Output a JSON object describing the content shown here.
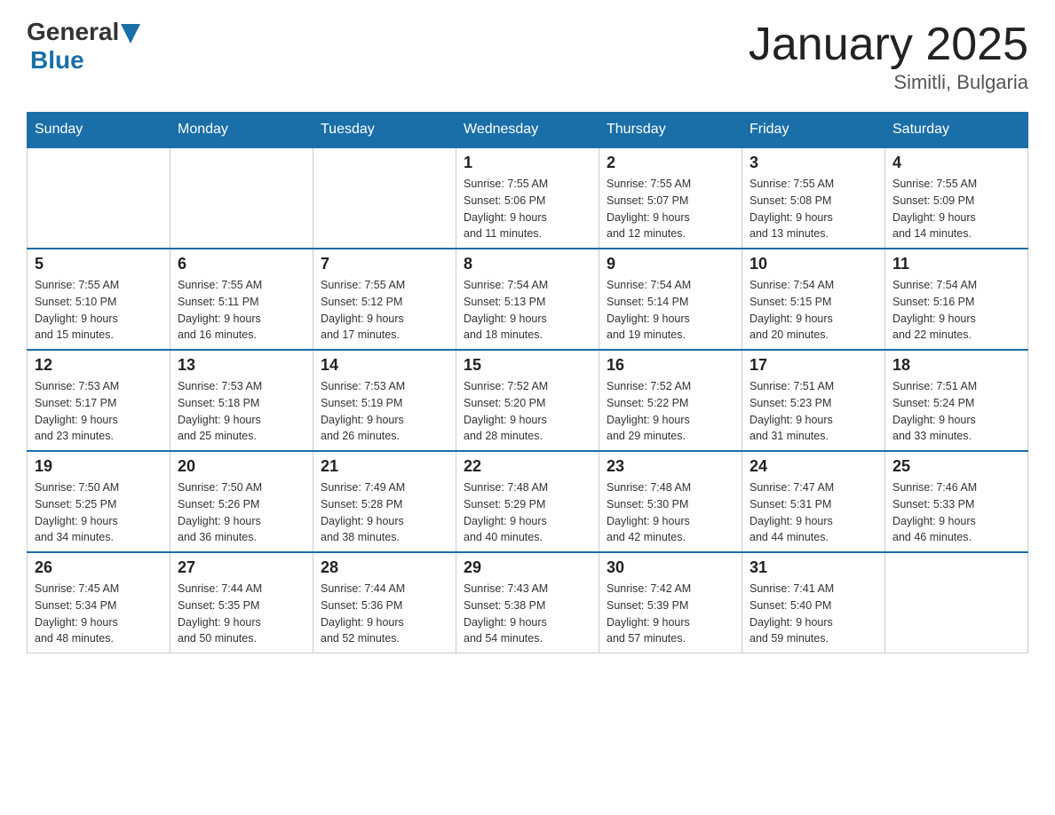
{
  "header": {
    "logo": {
      "general": "General",
      "blue": "Blue"
    },
    "title": "January 2025",
    "subtitle": "Simitli, Bulgaria"
  },
  "calendar": {
    "days_of_week": [
      "Sunday",
      "Monday",
      "Tuesday",
      "Wednesday",
      "Thursday",
      "Friday",
      "Saturday"
    ],
    "weeks": [
      [
        {
          "day": "",
          "info": ""
        },
        {
          "day": "",
          "info": ""
        },
        {
          "day": "",
          "info": ""
        },
        {
          "day": "1",
          "info": "Sunrise: 7:55 AM\nSunset: 5:06 PM\nDaylight: 9 hours\nand 11 minutes."
        },
        {
          "day": "2",
          "info": "Sunrise: 7:55 AM\nSunset: 5:07 PM\nDaylight: 9 hours\nand 12 minutes."
        },
        {
          "day": "3",
          "info": "Sunrise: 7:55 AM\nSunset: 5:08 PM\nDaylight: 9 hours\nand 13 minutes."
        },
        {
          "day": "4",
          "info": "Sunrise: 7:55 AM\nSunset: 5:09 PM\nDaylight: 9 hours\nand 14 minutes."
        }
      ],
      [
        {
          "day": "5",
          "info": "Sunrise: 7:55 AM\nSunset: 5:10 PM\nDaylight: 9 hours\nand 15 minutes."
        },
        {
          "day": "6",
          "info": "Sunrise: 7:55 AM\nSunset: 5:11 PM\nDaylight: 9 hours\nand 16 minutes."
        },
        {
          "day": "7",
          "info": "Sunrise: 7:55 AM\nSunset: 5:12 PM\nDaylight: 9 hours\nand 17 minutes."
        },
        {
          "day": "8",
          "info": "Sunrise: 7:54 AM\nSunset: 5:13 PM\nDaylight: 9 hours\nand 18 minutes."
        },
        {
          "day": "9",
          "info": "Sunrise: 7:54 AM\nSunset: 5:14 PM\nDaylight: 9 hours\nand 19 minutes."
        },
        {
          "day": "10",
          "info": "Sunrise: 7:54 AM\nSunset: 5:15 PM\nDaylight: 9 hours\nand 20 minutes."
        },
        {
          "day": "11",
          "info": "Sunrise: 7:54 AM\nSunset: 5:16 PM\nDaylight: 9 hours\nand 22 minutes."
        }
      ],
      [
        {
          "day": "12",
          "info": "Sunrise: 7:53 AM\nSunset: 5:17 PM\nDaylight: 9 hours\nand 23 minutes."
        },
        {
          "day": "13",
          "info": "Sunrise: 7:53 AM\nSunset: 5:18 PM\nDaylight: 9 hours\nand 25 minutes."
        },
        {
          "day": "14",
          "info": "Sunrise: 7:53 AM\nSunset: 5:19 PM\nDaylight: 9 hours\nand 26 minutes."
        },
        {
          "day": "15",
          "info": "Sunrise: 7:52 AM\nSunset: 5:20 PM\nDaylight: 9 hours\nand 28 minutes."
        },
        {
          "day": "16",
          "info": "Sunrise: 7:52 AM\nSunset: 5:22 PM\nDaylight: 9 hours\nand 29 minutes."
        },
        {
          "day": "17",
          "info": "Sunrise: 7:51 AM\nSunset: 5:23 PM\nDaylight: 9 hours\nand 31 minutes."
        },
        {
          "day": "18",
          "info": "Sunrise: 7:51 AM\nSunset: 5:24 PM\nDaylight: 9 hours\nand 33 minutes."
        }
      ],
      [
        {
          "day": "19",
          "info": "Sunrise: 7:50 AM\nSunset: 5:25 PM\nDaylight: 9 hours\nand 34 minutes."
        },
        {
          "day": "20",
          "info": "Sunrise: 7:50 AM\nSunset: 5:26 PM\nDaylight: 9 hours\nand 36 minutes."
        },
        {
          "day": "21",
          "info": "Sunrise: 7:49 AM\nSunset: 5:28 PM\nDaylight: 9 hours\nand 38 minutes."
        },
        {
          "day": "22",
          "info": "Sunrise: 7:48 AM\nSunset: 5:29 PM\nDaylight: 9 hours\nand 40 minutes."
        },
        {
          "day": "23",
          "info": "Sunrise: 7:48 AM\nSunset: 5:30 PM\nDaylight: 9 hours\nand 42 minutes."
        },
        {
          "day": "24",
          "info": "Sunrise: 7:47 AM\nSunset: 5:31 PM\nDaylight: 9 hours\nand 44 minutes."
        },
        {
          "day": "25",
          "info": "Sunrise: 7:46 AM\nSunset: 5:33 PM\nDaylight: 9 hours\nand 46 minutes."
        }
      ],
      [
        {
          "day": "26",
          "info": "Sunrise: 7:45 AM\nSunset: 5:34 PM\nDaylight: 9 hours\nand 48 minutes."
        },
        {
          "day": "27",
          "info": "Sunrise: 7:44 AM\nSunset: 5:35 PM\nDaylight: 9 hours\nand 50 minutes."
        },
        {
          "day": "28",
          "info": "Sunrise: 7:44 AM\nSunset: 5:36 PM\nDaylight: 9 hours\nand 52 minutes."
        },
        {
          "day": "29",
          "info": "Sunrise: 7:43 AM\nSunset: 5:38 PM\nDaylight: 9 hours\nand 54 minutes."
        },
        {
          "day": "30",
          "info": "Sunrise: 7:42 AM\nSunset: 5:39 PM\nDaylight: 9 hours\nand 57 minutes."
        },
        {
          "day": "31",
          "info": "Sunrise: 7:41 AM\nSunset: 5:40 PM\nDaylight: 9 hours\nand 59 minutes."
        },
        {
          "day": "",
          "info": ""
        }
      ]
    ]
  }
}
